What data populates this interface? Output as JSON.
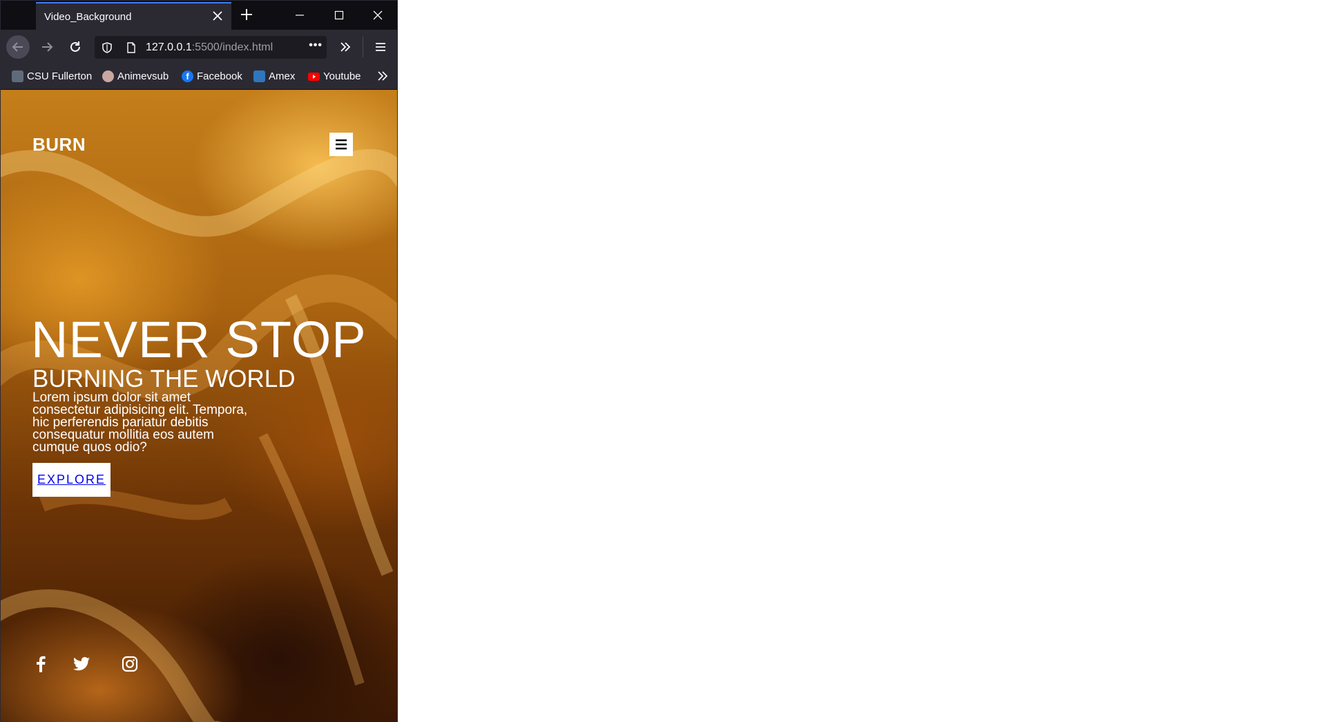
{
  "tab": {
    "title": "Video_Background"
  },
  "address_bar": {
    "host": "127.0.0.1",
    "path": ":5500/index.html",
    "more_label": "•••"
  },
  "bookmarks": [
    {
      "label": "CSU Fullerton",
      "icon": "csuf-icon",
      "color": "#5f6b7a"
    },
    {
      "label": "Animevsub",
      "icon": "animevsub-icon",
      "color": "#c9a7a0"
    },
    {
      "label": "Facebook",
      "icon": "facebook-icon",
      "color": "#1877f2"
    },
    {
      "label": "Amex",
      "icon": "amex-icon",
      "color": "#2e77bc"
    },
    {
      "label": "Youtube",
      "icon": "youtube-icon",
      "color": "#ff0000"
    }
  ],
  "page": {
    "logo": "BURN",
    "menu_icon": "hamburger-icon",
    "title": "NEVER STOP",
    "subtitle": "BURNING THE WORLD",
    "body": "Lorem ipsum dolor sit amet consectetur adipisicing elit. Tempora, hic perferendis pariatur debitis consequatur mollitia eos autem cumque quos odio?",
    "cta_label": "EXPLORE",
    "social": [
      "facebook-icon",
      "twitter-icon",
      "instagram-icon"
    ]
  },
  "colors": {
    "tab_accent": "#3e7bf7",
    "chrome_bg": "#2b2a33",
    "link": "#0000ee"
  }
}
